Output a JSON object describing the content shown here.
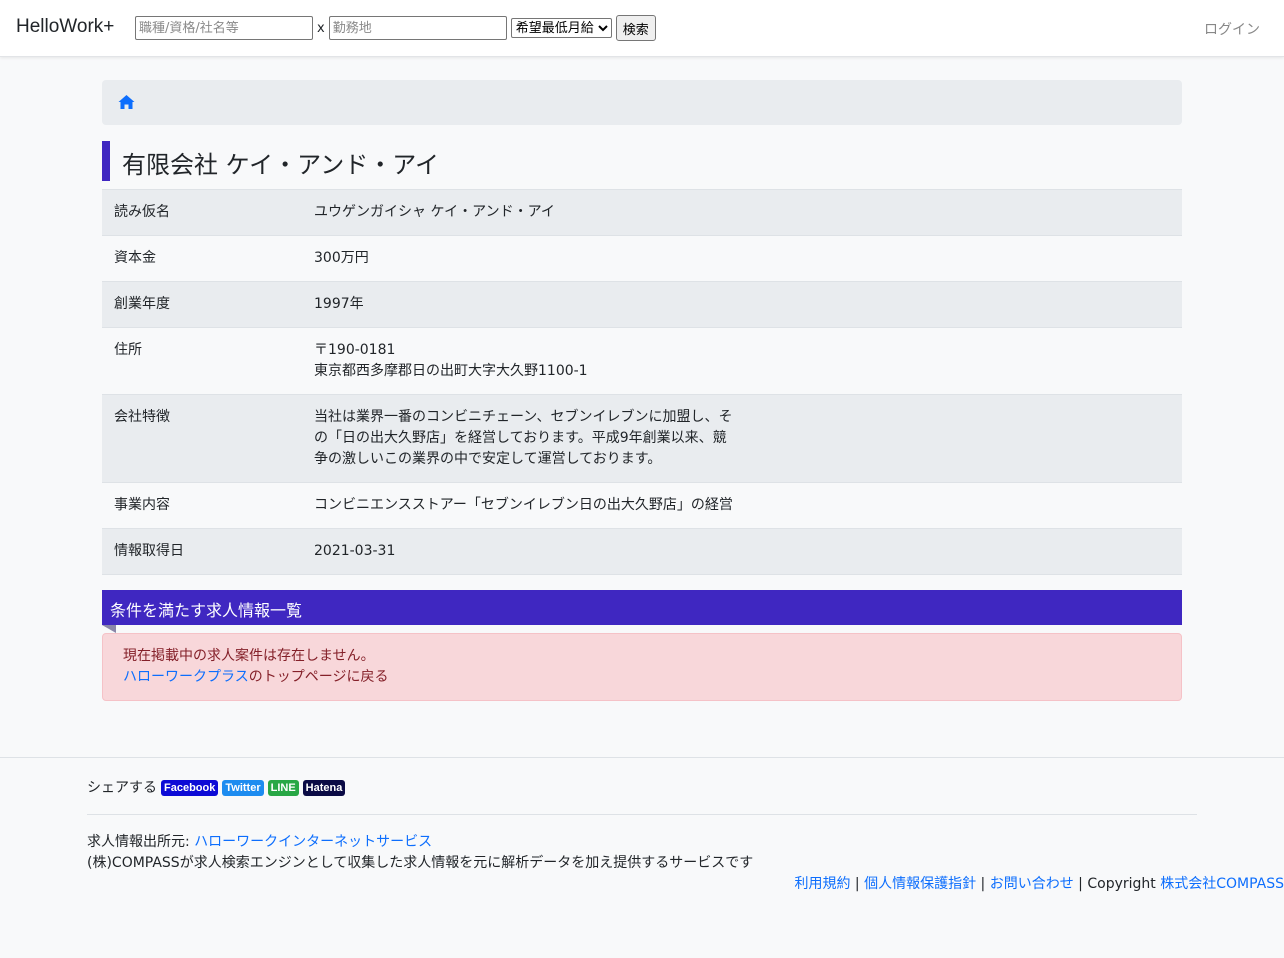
{
  "navbar": {
    "brand": "HelloWork+",
    "job_input_placeholder": "職種/資格/社名等",
    "separator": "x",
    "location_input_placeholder": "勤務地",
    "salary_select_value": "希望最低月給",
    "search_button": "検索",
    "login": "ログイン"
  },
  "breadcrumb": {
    "icon": "home-icon"
  },
  "company": {
    "name": "有限会社 ケイ・アンド・アイ",
    "rows": [
      {
        "label": "読み仮名",
        "lines": [
          "ユウゲンガイシャ ケイ・アンド・アイ"
        ]
      },
      {
        "label": "資本金",
        "lines": [
          "300万円"
        ]
      },
      {
        "label": "創業年度",
        "lines": [
          "1997年"
        ]
      },
      {
        "label": "住所",
        "lines": [
          "〒190-0181",
          "東京都西多摩郡日の出町大字大久野1100-1"
        ]
      },
      {
        "label": "会社特徴",
        "lines": [
          "当社は業界一番のコンビニチェーン、セブンイレブンに加盟し、そ",
          "の「日の出大久野店」を経営しております。平成9年創業以来、競",
          "争の激しいこの業界の中で安定して運営しております。"
        ]
      },
      {
        "label": "事業内容",
        "lines": [
          "コンビニエンスストアー「セブンイレブン日の出大久野店」の経営"
        ]
      },
      {
        "label": "情報取得日",
        "lines": [
          "2021-03-31"
        ]
      }
    ]
  },
  "jobs_section": {
    "title": "条件を満たす求人情報一覧",
    "empty_message": "現在掲載中の求人案件は存在しません。",
    "home_link": "ハローワークプラス",
    "home_link_suffix": "のトップページに戻る"
  },
  "footer": {
    "share_label": "シェアする",
    "share_buttons": [
      {
        "label": "Facebook",
        "color": "#0d0bd6"
      },
      {
        "label": "Twitter",
        "color": "#1d8cf0"
      },
      {
        "label": "LINE",
        "color": "#28a745"
      },
      {
        "label": "Hatena",
        "color": "#0b0b45"
      }
    ],
    "source_label": "求人情報出所元: ",
    "source_link": "ハローワークインターネットサービス",
    "description": "(株)COMPASSが求人検索エンジンとして収集した求人情報を元に解析データを加え提供するサービスです",
    "terms": "利用規約",
    "privacy": "個人情報保護指針",
    "contact": "お問い合わせ",
    "separator": " | ",
    "copyright": "Copyright ",
    "company_link": "株式会社COMPASS"
  },
  "colors": {
    "accent": "#3f27c1",
    "link": "#0d6efd",
    "alert_bg": "#f8d7da",
    "alert_text": "#842029"
  }
}
